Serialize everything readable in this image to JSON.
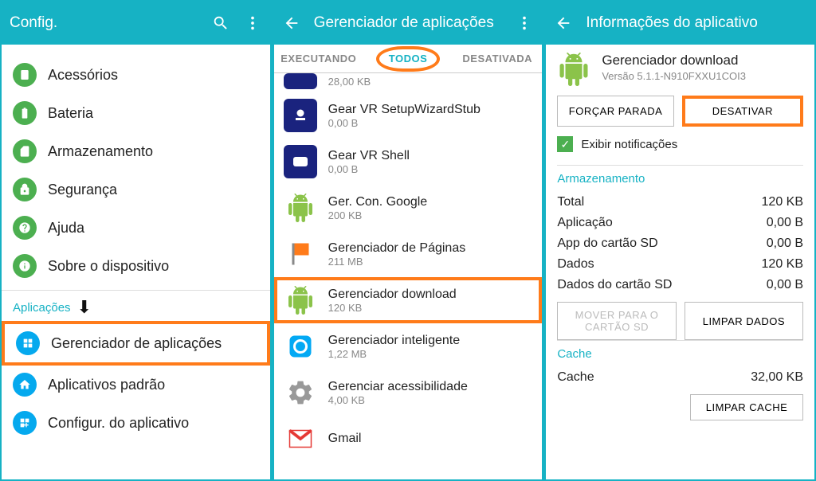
{
  "panel1": {
    "title": "Config.",
    "items": [
      {
        "label": "Acessórios"
      },
      {
        "label": "Bateria"
      },
      {
        "label": "Armazenamento"
      },
      {
        "label": "Segurança"
      },
      {
        "label": "Ajuda"
      },
      {
        "label": "Sobre o dispositivo"
      }
    ],
    "section": "Aplicações",
    "apps_items": [
      {
        "label": "Gerenciador de aplicações"
      },
      {
        "label": "Aplicativos padrão"
      },
      {
        "label": "Configur. do aplicativo"
      }
    ]
  },
  "panel2": {
    "title": "Gerenciador de aplicações",
    "tabs": [
      "EXECUTANDO",
      "TODOS",
      "DESATIVADA"
    ],
    "partial_size": "28,00 KB",
    "apps": [
      {
        "name": "Gear VR SetupWizardStub",
        "size": "0,00 B"
      },
      {
        "name": "Gear VR Shell",
        "size": "0,00 B"
      },
      {
        "name": "Ger. Con. Google",
        "size": "200 KB"
      },
      {
        "name": "Gerenciador de Páginas",
        "size": "211 MB"
      },
      {
        "name": "Gerenciador download",
        "size": "120 KB"
      },
      {
        "name": "Gerenciador inteligente",
        "size": "1,22 MB"
      },
      {
        "name": "Gerenciar acessibilidade",
        "size": "4,00 KB"
      },
      {
        "name": "Gmail",
        "size": ""
      }
    ]
  },
  "panel3": {
    "title": "Informações do aplicativo",
    "app_name": "Gerenciador download",
    "app_version": "Versão 5.1.1-N910FXXU1COI3",
    "btn_force": "FORÇAR PARADA",
    "btn_disable": "DESATIVAR",
    "show_notif": "Exibir notificações",
    "sec_storage": "Armazenamento",
    "rows": [
      {
        "k": "Total",
        "v": "120 KB"
      },
      {
        "k": "Aplicação",
        "v": "0,00 B"
      },
      {
        "k": "App do cartão SD",
        "v": "0,00 B"
      },
      {
        "k": "Dados",
        "v": "120 KB"
      },
      {
        "k": "Dados do cartão SD",
        "v": "0,00 B"
      }
    ],
    "btn_move": "MOVER PARA O CARTÃO SD",
    "btn_clear_data": "LIMPAR DADOS",
    "sec_cache": "Cache",
    "cache_k": "Cache",
    "cache_v": "32,00 KB",
    "btn_clear_cache": "LIMPAR CACHE"
  }
}
